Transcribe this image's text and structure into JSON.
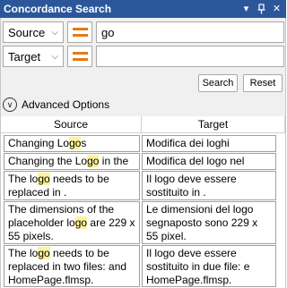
{
  "window": {
    "title": "Concordance Search",
    "controls": [
      "dropdown-icon",
      "pin-icon",
      "close-icon"
    ]
  },
  "search": {
    "row1": {
      "dropdown_label": "Source",
      "value": "go"
    },
    "row2": {
      "dropdown_label": "Target",
      "value": ""
    },
    "search_button": "Search",
    "reset_button": "Reset"
  },
  "advanced": {
    "label": "Advanced Options"
  },
  "grid": {
    "columns": [
      "Source",
      "Target"
    ],
    "rows": [
      {
        "source": [
          {
            "t": "Changing Lo"
          },
          {
            "t": "go",
            "hl": true
          },
          {
            "t": "s"
          }
        ],
        "target": "Modifica dei loghi"
      },
      {
        "source": [
          {
            "t": "Changing the Lo"
          },
          {
            "t": "go",
            "hl": true
          },
          {
            "t": " in the"
          }
        ],
        "target": "Modifica del logo nel"
      },
      {
        "source": [
          {
            "t": "The lo"
          },
          {
            "t": "go",
            "hl": true
          },
          {
            "t": " needs to be replaced in ."
          }
        ],
        "target": "Il logo deve essere sostituito in ."
      },
      {
        "source": [
          {
            "t": "The dimensions of the placeholder lo"
          },
          {
            "t": "go",
            "hl": true
          },
          {
            "t": " are 229 x 55 pixels."
          }
        ],
        "target": "Le dimensioni del logo segnaposto sono 229 x 55 pixel."
      },
      {
        "source": [
          {
            "t": "The lo"
          },
          {
            "t": "go",
            "hl": true
          },
          {
            "t": " needs to be replaced in two files:  and HomePage.flmsp."
          }
        ],
        "target": "Il logo deve essere sostituito in due file:  e HomePage.flmsp."
      }
    ]
  },
  "colors": {
    "titlebar": "#2b579a",
    "highlight": "#fef39a",
    "lines_icon": "#e07b18",
    "panel": "#f0f0f0"
  }
}
